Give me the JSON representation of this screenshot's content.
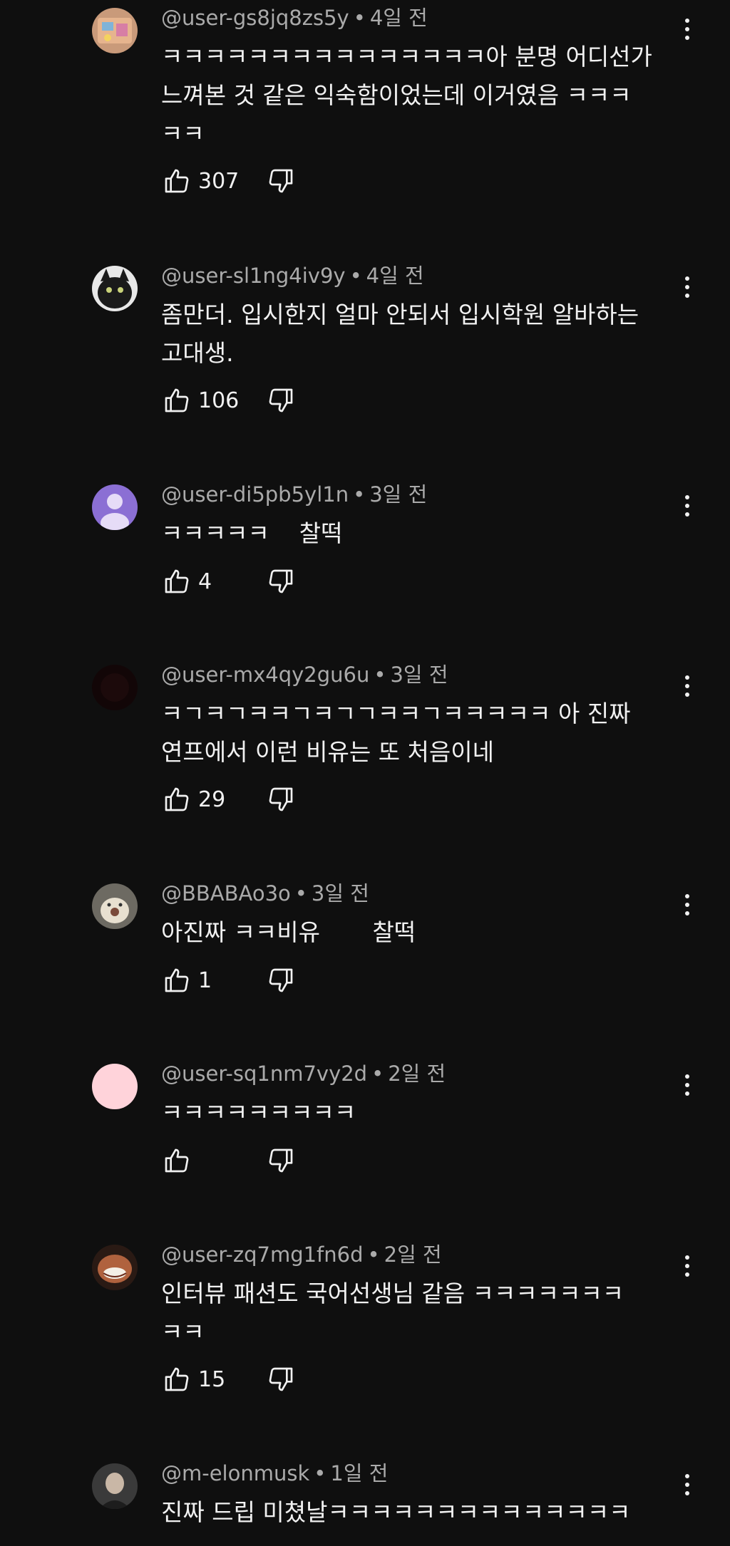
{
  "comments": [
    {
      "author": "@user-gs8jq8zs5y",
      "time": "4일 전",
      "text": "ㅋㅋㅋㅋㅋㅋㅋㅋㅋㅋㅋㅋㅋㅋㅋ아 분명 어디선가\n느껴본 것 같은 익숙함이었는데 이거였음 ㅋㅋㅋ\nㅋㅋ",
      "likes": "307"
    },
    {
      "author": "@user-sl1ng4iv9y",
      "time": "4일 전",
      "text": "좀만더. 입시한지 얼마 안되서 입시학원 알바하는\n고대생.",
      "likes": "106"
    },
    {
      "author": "@user-di5pb5yl1n",
      "time": "3일 전",
      "text": "ㅋㅋㅋㅋㅋ    찰떡",
      "likes": "4"
    },
    {
      "author": "@user-mx4qy2gu6u",
      "time": "3일 전",
      "text": "ㅋㄱㅋㄱㅋㅋㄱㅋㄱㄱㅋㅋㄱㅋㅋㅋㅋㅋ 아 진짜\n연프에서 이런 비유는 또 처음이네",
      "likes": "29"
    },
    {
      "author": "@BBABAo3o",
      "time": "3일 전",
      "text": "아진짜 ㅋㅋ비유       찰떡",
      "likes": "1"
    },
    {
      "author": "@user-sq1nm7vy2d",
      "time": "2일 전",
      "text": "ㅋㅋㅋㅋㅋㅋㅋㅋㅋ",
      "likes": ""
    },
    {
      "author": "@user-zq7mg1fn6d",
      "time": "2일 전",
      "text": "인터뷰 패션도 국어선생님 같음 ㅋㅋㅋㅋㅋㅋㅋ\nㅋㅋ",
      "likes": "15"
    },
    {
      "author": "@m-elonmusk",
      "time": "1일 전",
      "text": "진짜 드립 미쳤날ㅋㅋㅋㅋㅋㅋㅋㅋㅋㅋㅋㅋㅋㅋ",
      "likes": ""
    }
  ],
  "separator": "•",
  "icons": {
    "like": "thumbs-up-icon",
    "dislike": "thumbs-down-icon",
    "more": "more-vert-icon"
  },
  "colors": {
    "background": "#0f0f0f",
    "text": "#f1f1f1",
    "meta": "#aaaaaa"
  }
}
